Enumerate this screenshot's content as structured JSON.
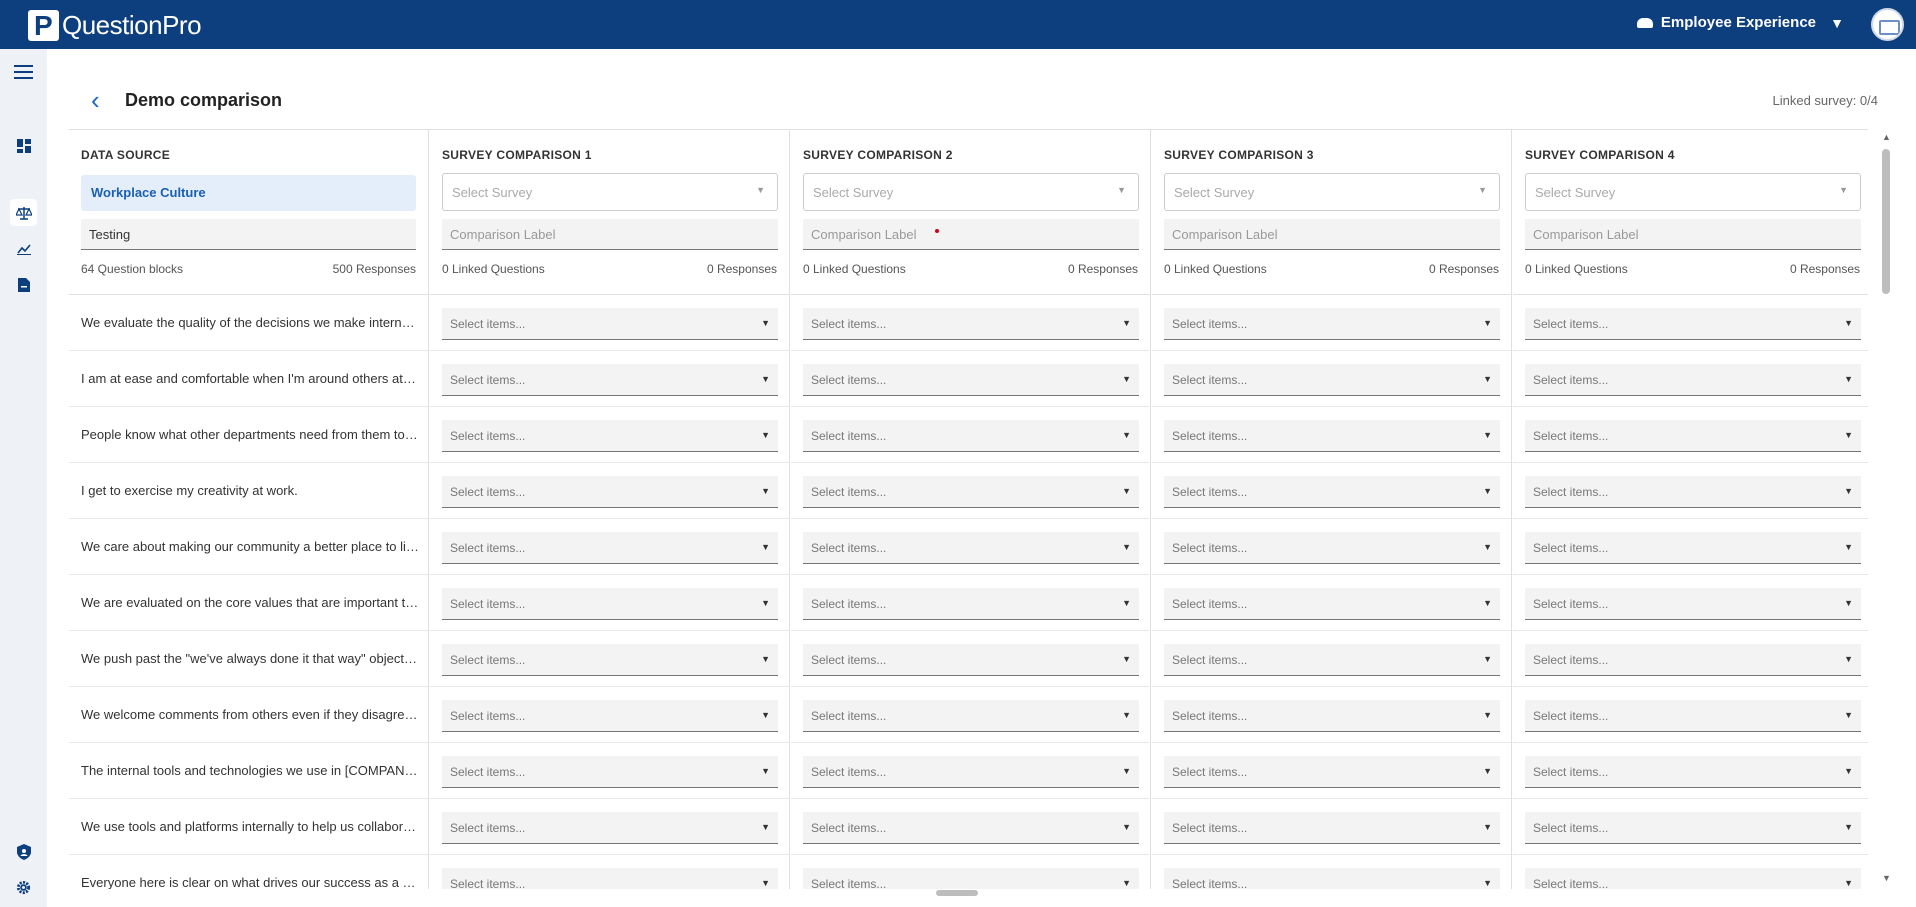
{
  "app": {
    "logo_letter": "P",
    "logo_text": "QuestionPro",
    "product": "Employee Experience",
    "caret": "▼"
  },
  "nav": {
    "icons": [
      "menu-icon",
      "dashboard-icon",
      "compare-icon",
      "trend-chart-icon",
      "report-icon",
      "shield-user-icon",
      "settings-icon"
    ]
  },
  "page": {
    "back": "‹",
    "title": "Demo comparison",
    "linked_survey": "Linked survey: 0/4"
  },
  "data_source": {
    "title": "DATA SOURCE",
    "selected": "Workplace Culture",
    "secondary": "Testing",
    "question_blocks": "64 Question blocks",
    "responses": "500 Responses"
  },
  "comparisons": [
    {
      "title": "SURVEY COMPARISON 1",
      "select_placeholder": "Select Survey",
      "label_placeholder": "Comparison Label",
      "linked_questions": "0 Linked Questions",
      "responses": "0 Responses",
      "required": false
    },
    {
      "title": "SURVEY COMPARISON 2",
      "select_placeholder": "Select Survey",
      "label_placeholder": "Comparison Label",
      "linked_questions": "0 Linked Questions",
      "responses": "0 Responses",
      "required": true
    },
    {
      "title": "SURVEY COMPARISON 3",
      "select_placeholder": "Select Survey",
      "label_placeholder": "Comparison Label",
      "linked_questions": "0 Linked Questions",
      "responses": "0 Responses",
      "required": false
    },
    {
      "title": "SURVEY COMPARISON 4",
      "select_placeholder": "Select Survey",
      "label_placeholder": "Comparison Label",
      "linked_questions": "0 Linked Questions",
      "responses": "0 Responses",
      "required": false
    }
  ],
  "items_placeholder": "Select items...",
  "questions": [
    "We evaluate the quality of the decisions we make internally",
    "I am at ease and comfortable when I'm around others at work",
    "People know what other departments need from them to succeed",
    "I get to exercise my creativity at work.",
    "We care about making our community a better place to live",
    "We are evaluated on the core values that are important to us",
    "We push past the \"we've always done it that way\" objections",
    "We welcome comments from others even if they disagree with us",
    "The internal tools and technologies we use in [COMPANY] are great",
    "We use tools and platforms internally to help us collaborate",
    "Everyone here is clear on what drives our success as a company"
  ]
}
